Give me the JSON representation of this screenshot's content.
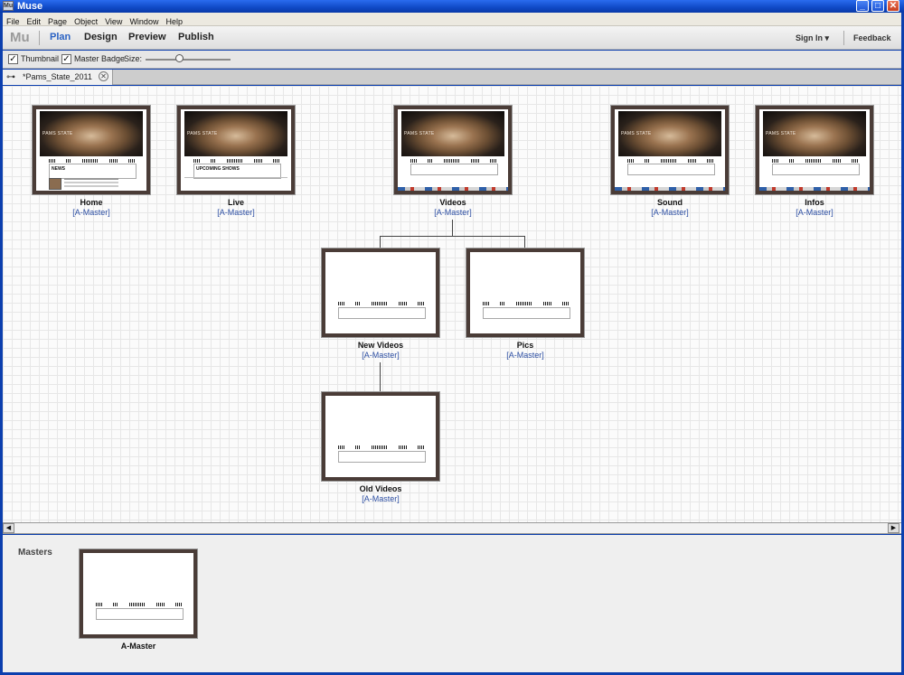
{
  "window": {
    "title": "Muse",
    "app_icon": "Mu",
    "min": "_",
    "max": "□",
    "close": "✕"
  },
  "menu": [
    "File",
    "Edit",
    "Page",
    "Object",
    "View",
    "Window",
    "Help"
  ],
  "workspace": {
    "logo": "Mu",
    "nav": [
      "Plan",
      "Design",
      "Preview",
      "Publish"
    ],
    "active": "Plan",
    "sign_in": "Sign In ▾",
    "feedback": "Feedback"
  },
  "options": {
    "thumbnail_label": "Thumbnail",
    "thumbnail_checked": true,
    "master_badge_label": "Master Badge",
    "master_badge_checked": true,
    "size_label": "Size:",
    "check_mark": "✓"
  },
  "tab": {
    "title": "*Pams_State_2011",
    "icon": "site-map-icon",
    "close": "✕"
  },
  "thumb_text": {
    "brand": "PAMS STATE",
    "news": "NEWS",
    "live": "UPCOMING SHOWS"
  },
  "pages": [
    {
      "name": "Home",
      "master": "[A-Master]",
      "style": "home"
    },
    {
      "name": "Live",
      "master": "[A-Master]",
      "style": "live"
    },
    {
      "name": "Videos",
      "master": "[A-Master]",
      "style": "photo"
    },
    {
      "name": "Sound",
      "master": "[A-Master]",
      "style": "photo"
    },
    {
      "name": "Infos",
      "master": "[A-Master]",
      "style": "photo"
    },
    {
      "name": "New Videos",
      "master": "[A-Master]",
      "style": "blank"
    },
    {
      "name": "Pics",
      "master": "[A-Master]",
      "style": "blank"
    },
    {
      "name": "Old Videos",
      "master": "[A-Master]",
      "style": "blank"
    }
  ],
  "masters": {
    "title": "Masters",
    "items": [
      {
        "name": "A-Master"
      }
    ]
  },
  "scroll": {
    "left": "◀",
    "right": "▶"
  },
  "colors": {
    "accent": "#2a62c4",
    "frame": "#4a3c37",
    "master_link": "#2d4fa3",
    "titlebar": "#0f49c6"
  }
}
